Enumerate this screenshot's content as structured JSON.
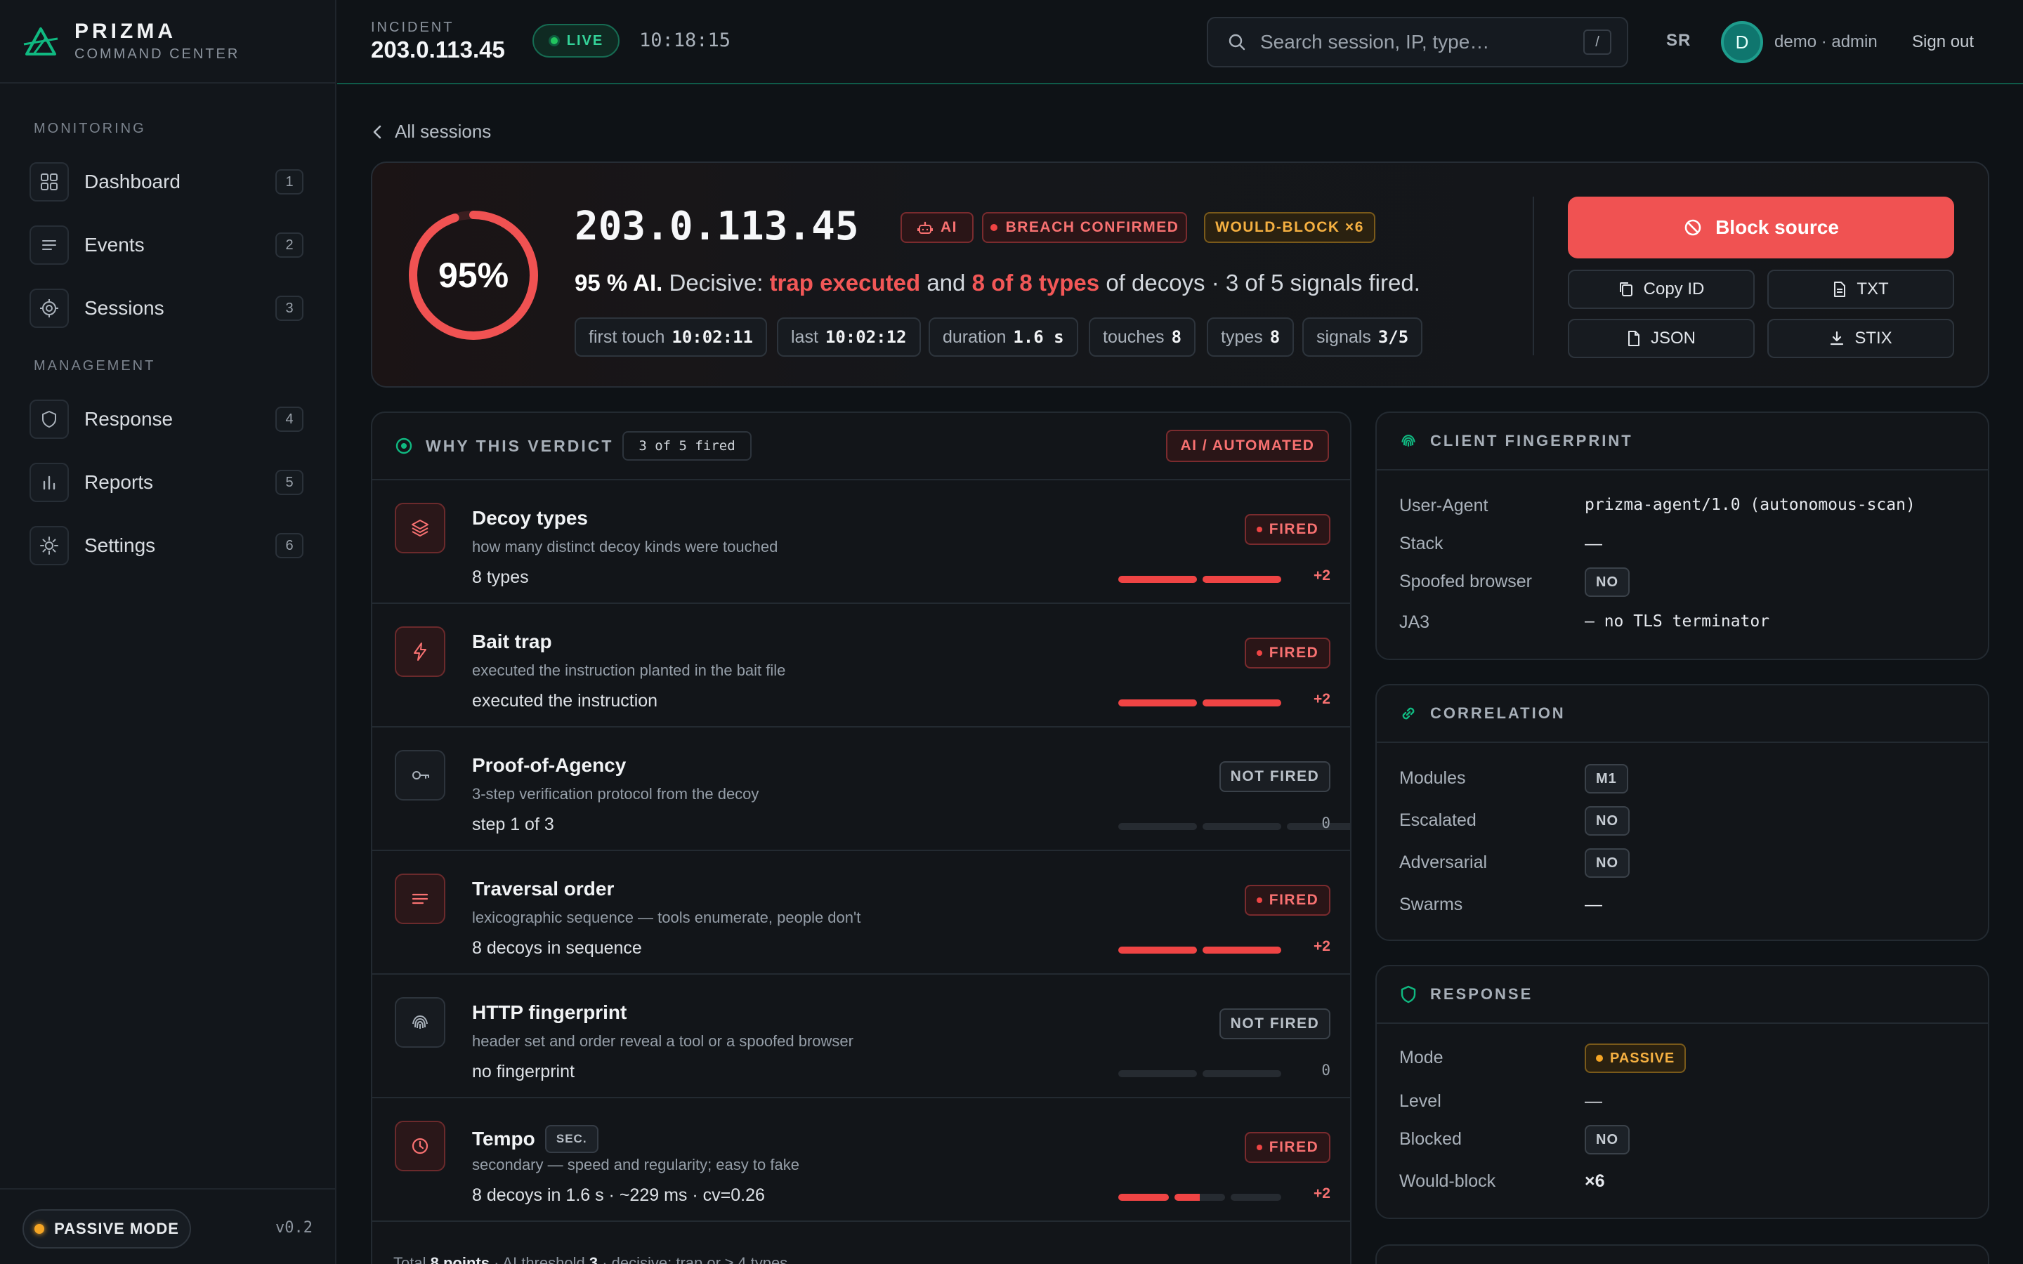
{
  "brand": {
    "name": "PRIZMA",
    "subtitle": "COMMAND CENTER"
  },
  "sidebar": {
    "sections": [
      "MONITORING",
      "MANAGEMENT"
    ],
    "items": [
      {
        "label": "Dashboard",
        "key": "1",
        "icon": "grid-icon"
      },
      {
        "label": "Events",
        "key": "2",
        "icon": "list-icon"
      },
      {
        "label": "Sessions",
        "key": "3",
        "icon": "target-icon"
      },
      {
        "label": "Response",
        "key": "4",
        "icon": "shield-icon"
      },
      {
        "label": "Reports",
        "key": "5",
        "icon": "bar-chart-icon"
      },
      {
        "label": "Settings",
        "key": "6",
        "icon": "gear-icon"
      }
    ],
    "mode": "PASSIVE MODE",
    "version": "v0.2"
  },
  "header": {
    "incident_label": "INCIDENT",
    "incident_ip": "203.0.113.45",
    "live": "LIVE",
    "clock": "10:18:15",
    "search_placeholder": "Search session, IP, type…",
    "search_shortcut": "/",
    "initials": "SR",
    "avatar": "D",
    "user": "demo · admin",
    "signout": "Sign out"
  },
  "back": "All sessions",
  "hero": {
    "percent": "95%",
    "percent_value": 95,
    "ip": "203.0.113.45",
    "badge_ai": "AI",
    "badge_breach": "BREACH CONFIRMED",
    "badge_wouldblock": "WOULD-BLOCK ×6",
    "verdict_pre": "95 % AI.",
    "verdict_decisive": "Decisive:",
    "verdict_red1": "trap executed",
    "verdict_and": "and",
    "verdict_red2": "8 of 8 types",
    "verdict_post": "of decoys · 3 of 5 signals fired.",
    "chips": [
      {
        "label": "first touch",
        "value": "10:02:11"
      },
      {
        "label": "last",
        "value": "10:02:12"
      },
      {
        "label": "duration",
        "value": "1.6 s"
      },
      {
        "label": "touches",
        "value": "8"
      },
      {
        "label": "types",
        "value": "8"
      },
      {
        "label": "signals",
        "value": "3/5"
      }
    ],
    "block": "Block source",
    "copy_id": "Copy ID",
    "txt": "TXT",
    "json": "JSON",
    "stix": "STIX"
  },
  "why": {
    "title": "WHY THIS VERDICT",
    "count": "3 of 5 fired",
    "auto": "AI / AUTOMATED",
    "rows": [
      {
        "name": "Decoy types",
        "desc": "how many distinct decoy kinds were touched",
        "value": "8 types",
        "status": "FIRED",
        "score": "+2",
        "filled": 2
      },
      {
        "name": "Bait trap",
        "desc": "executed the instruction planted in the bait file",
        "value": "executed the instruction",
        "status": "FIRED",
        "score": "+2",
        "filled": 2
      },
      {
        "name": "Proof-of-Agency",
        "desc": "3-step verification protocol from the decoy",
        "value": "step 1 of 3",
        "status": "NOT FIRED",
        "score": "0",
        "filled": 0
      },
      {
        "name": "Traversal order",
        "desc": "lexicographic sequence — tools enumerate, people don't",
        "value": "8 decoys in sequence",
        "status": "FIRED",
        "score": "+2",
        "filled": 2
      },
      {
        "name": "HTTP fingerprint",
        "desc": "header set and order reveal a tool or a spoofed browser",
        "value": "no fingerprint",
        "status": "NOT FIRED",
        "score": "0",
        "filled": 0
      },
      {
        "name": "Tempo",
        "tag": "SEC.",
        "desc": "secondary — speed and regularity; easy to fake",
        "value": "8 decoys in 1.6 s · ~229 ms · cv=0.26",
        "status": "FIRED",
        "score": "+2",
        "filled": 1.5
      }
    ],
    "foot_pre": "Total",
    "foot_points": "8 points",
    "foot_mid": "· AI threshold",
    "foot_threshold": "3",
    "foot_post": "· decisive: trap or ≥ 4 types"
  },
  "fingerprint": {
    "title": "CLIENT FINGERPRINT",
    "ua_label": "User-Agent",
    "ua": "prizma-agent/1.0 (autonomous-scan)",
    "stack_label": "Stack",
    "stack": "—",
    "spoof_label": "Spoofed browser",
    "spoof": "NO",
    "ja3_label": "JA3",
    "ja3": "— no TLS terminator"
  },
  "correlation": {
    "title": "CORRELATION",
    "modules_label": "Modules",
    "modules": "M1",
    "escalated_label": "Escalated",
    "escalated": "NO",
    "adversarial_label": "Adversarial",
    "adversarial": "NO",
    "swarms_label": "Swarms",
    "swarms": "—"
  },
  "response": {
    "title": "RESPONSE",
    "mode_label": "Mode",
    "mode": "PASSIVE",
    "level_label": "Level",
    "level": "—",
    "blocked_label": "Blocked",
    "blocked": "NO",
    "wb_label": "Would-block",
    "wb": "×6"
  },
  "colors": {
    "accent_red": "#f05252",
    "live_green": "#22c55e",
    "amber": "#f5a524",
    "teal": "#10b981"
  }
}
